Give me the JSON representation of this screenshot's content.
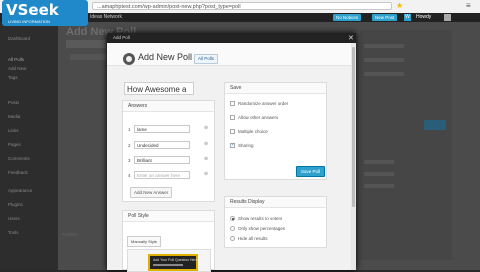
{
  "browser": {
    "url": "...amaphptest.com/wp-admin/post-new.php?post_type=poll"
  },
  "watermark": {
    "logo": "VSeek",
    "tagline": "LIVING INFORMATION"
  },
  "admin_bar": {
    "site_name": "Ideas Network",
    "new_content_label": "No Notices",
    "new_post_label": "New Post",
    "logo_letter": "W",
    "howdy": "Howdy"
  },
  "sidebar": {
    "items": [
      {
        "label": "Dashboard"
      },
      {
        "label": "All Polls"
      },
      {
        "label": "Add New"
      },
      {
        "label": "Tags"
      },
      {
        "label": "Posts"
      },
      {
        "label": "Media"
      },
      {
        "label": "Links"
      },
      {
        "label": "Pages"
      },
      {
        "label": "Comments"
      },
      {
        "label": "Feedback"
      },
      {
        "label": "Appearance"
      },
      {
        "label": "Plugins"
      },
      {
        "label": "Users"
      },
      {
        "label": "Tools"
      }
    ]
  },
  "background": {
    "title": "Add New Poll",
    "bottom_label": "Publish"
  },
  "modal": {
    "bar_title": "Add Poll",
    "title": "Add New Poll",
    "all_polls_label": "All Polls",
    "poll_question": "How Awesome a",
    "answers_title": "Answers",
    "answers": [
      {
        "num": "1",
        "value": "lame",
        "placeholder": ""
      },
      {
        "num": "2",
        "value": "Undecided",
        "placeholder": ""
      },
      {
        "num": "3",
        "value": "Brilliant",
        "placeholder": ""
      },
      {
        "num": "4",
        "value": "",
        "placeholder": "Enter an answer here"
      }
    ],
    "add_answer_label": "Add New Answer",
    "save_box_title": "Save",
    "save_options": [
      {
        "label": "Randomize answer order",
        "checked": false
      },
      {
        "label": "Allow other answers",
        "checked": false
      },
      {
        "label": "Multiple choice",
        "checked": false
      },
      {
        "label": "Sharing",
        "checked": true
      }
    ],
    "save_poll_label": "Save Poll",
    "results_title": "Results Display",
    "results_options": [
      {
        "label": "Show results to voters",
        "checked": true
      },
      {
        "label": "Only show percentages",
        "checked": false
      },
      {
        "label": "Hide all results",
        "checked": false
      }
    ],
    "poll_style_title": "Poll Style",
    "style_select_value": "Manually Style",
    "preview_text": "Add Your Poll Question Here"
  },
  "colors": {
    "accent": "#2ea2cc",
    "admin_bar": "#222222",
    "preview_border": "#e0b000"
  }
}
